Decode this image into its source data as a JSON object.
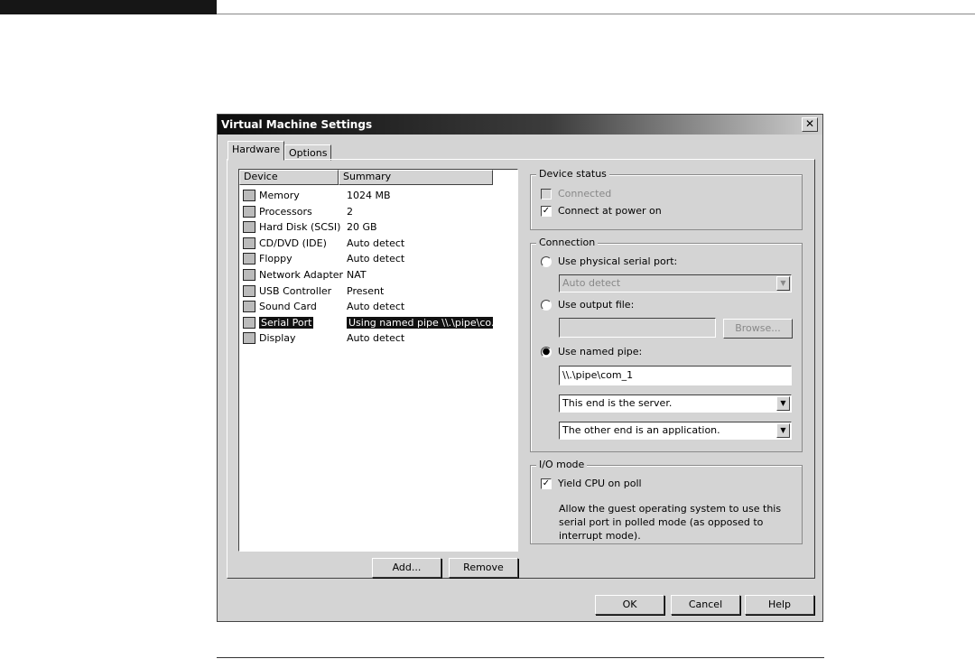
{
  "window": {
    "title": "Virtual Machine Settings",
    "close_glyph": "✕"
  },
  "tabs": [
    {
      "label": "Hardware",
      "active": true
    },
    {
      "label": "Options",
      "active": false
    }
  ],
  "device_list": {
    "columns": [
      "Device",
      "Summary"
    ],
    "rows": [
      {
        "name": "Memory",
        "summary": "1024 MB",
        "icon": "memory-icon",
        "selected": false
      },
      {
        "name": "Processors",
        "summary": "2",
        "icon": "processor-icon",
        "selected": false
      },
      {
        "name": "Hard Disk (SCSI)",
        "summary": "20 GB",
        "icon": "hard-disk-icon",
        "selected": false
      },
      {
        "name": "CD/DVD (IDE)",
        "summary": "Auto detect",
        "icon": "cd-dvd-icon",
        "selected": false
      },
      {
        "name": "Floppy",
        "summary": "Auto detect",
        "icon": "floppy-icon",
        "selected": false
      },
      {
        "name": "Network Adapter",
        "summary": "NAT",
        "icon": "network-adapter-icon",
        "selected": false
      },
      {
        "name": "USB Controller",
        "summary": "Present",
        "icon": "usb-icon",
        "selected": false
      },
      {
        "name": "Sound Card",
        "summary": "Auto detect",
        "icon": "sound-card-icon",
        "selected": false
      },
      {
        "name": "Serial Port",
        "summary": "Using named pipe \\\\.\\pipe\\co...",
        "icon": "serial-port-icon",
        "selected": true
      },
      {
        "name": "Display",
        "summary": "Auto detect",
        "icon": "display-icon",
        "selected": false
      }
    ],
    "add_label": "Add...",
    "remove_label": "Remove"
  },
  "device_status": {
    "legend": "Device status",
    "connected_label": "Connected",
    "connected_checked": false,
    "connect_power_label": "Connect at power on",
    "connect_power_checked": true
  },
  "connection": {
    "legend": "Connection",
    "physical_label": "Use physical serial port:",
    "physical_value": "Auto detect",
    "output_label": "Use output file:",
    "output_value": "",
    "browse_label": "Browse...",
    "named_pipe_label": "Use named pipe:",
    "selected_option": "named_pipe",
    "pipe_name": "\\\\.\\pipe\\com_1",
    "end_select": "This end is the server.",
    "other_end_select": "The other end is an application."
  },
  "io_mode": {
    "legend": "I/O mode",
    "yield_label": "Yield CPU on poll",
    "yield_checked": true,
    "description": "Allow the guest operating system to use this serial port in polled mode (as opposed to interrupt mode)."
  },
  "footer": {
    "ok_label": "OK",
    "cancel_label": "Cancel",
    "help_label": "Help"
  }
}
